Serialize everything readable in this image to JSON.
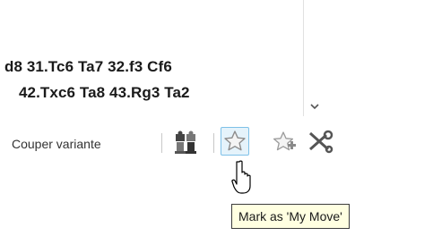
{
  "notation": {
    "line1": "d8  31.Tc6  Ta7  32.f3  Cf6",
    "line2": "42.Txc6  Ta8  43.Rg3  Ta2"
  },
  "toolbar": {
    "cut_variant_label": "Couper variante",
    "engine_icon": "chess-pieces-icon",
    "mark_icon": "star-icon",
    "add_mark_icon": "star-plus-icon",
    "cut_icon": "scissors-icon"
  },
  "tooltip": {
    "text": "Mark as 'My Move'"
  },
  "colors": {
    "hover_border": "#7ec1e8",
    "hover_fill": "#e5f3fb",
    "tooltip_bg": "#ffffe1"
  }
}
